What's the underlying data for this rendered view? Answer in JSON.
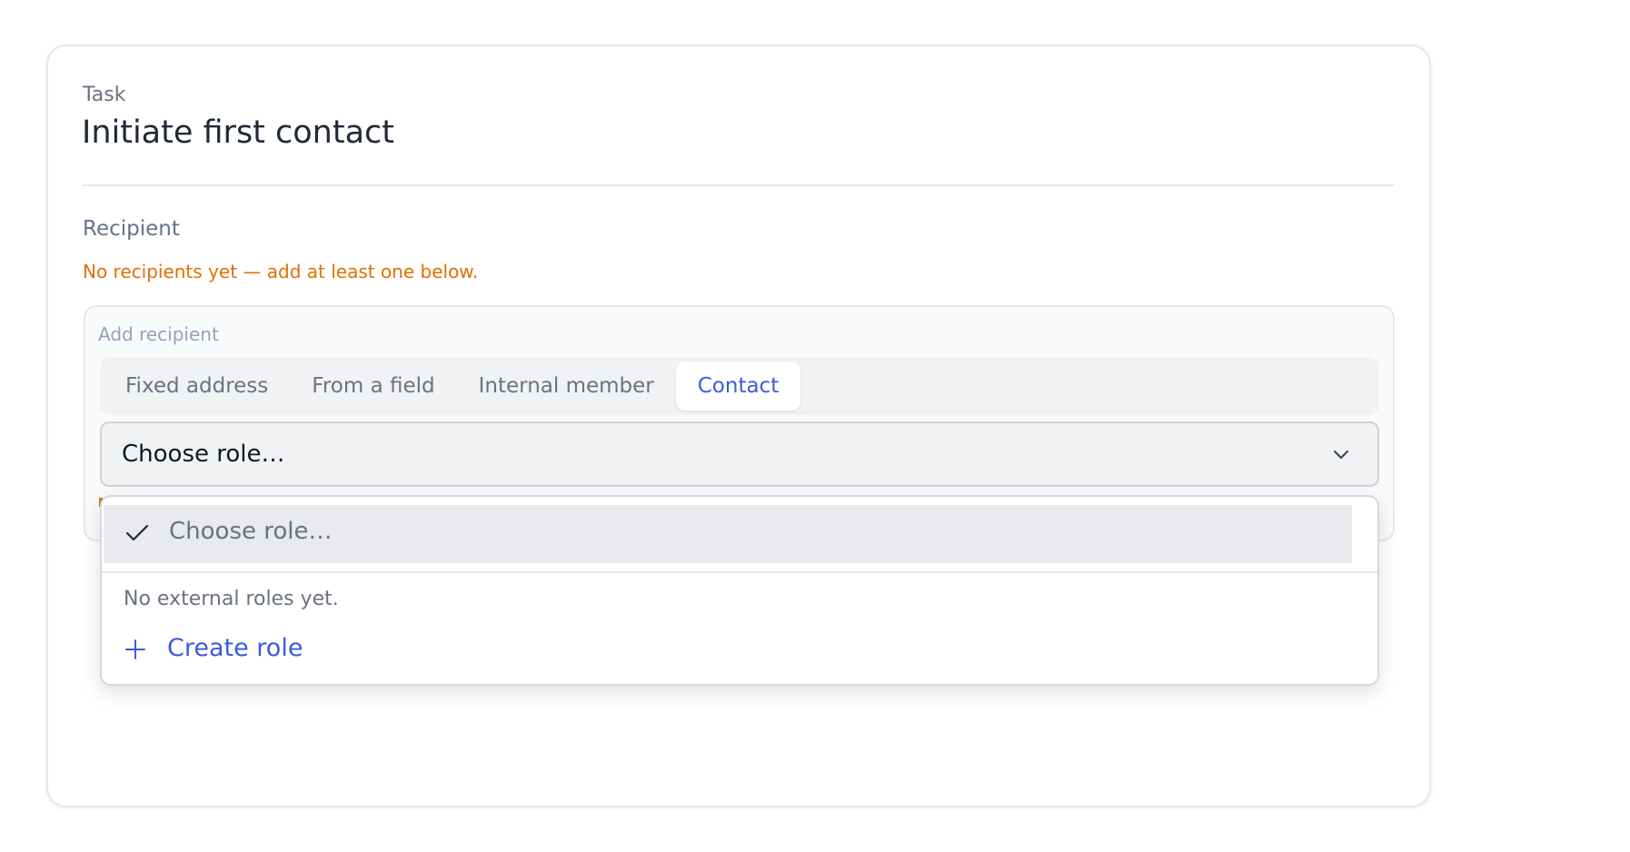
{
  "task": {
    "label": "Task",
    "title": "Initiate first contact"
  },
  "recipient": {
    "label": "Recipient",
    "warning": "No recipients yet — add at least one below.",
    "add_label": "Add recipient",
    "tabs": [
      {
        "label": "Fixed address",
        "active": false
      },
      {
        "label": "From a field",
        "active": false
      },
      {
        "label": "Internal member",
        "active": false
      },
      {
        "label": "Contact",
        "active": true
      }
    ],
    "select": {
      "value": "Choose role…"
    },
    "dropdown": {
      "selected_option": "Choose role…",
      "empty_note": "No external roles yet.",
      "create_label": "Create role"
    }
  },
  "colors": {
    "accent": "#3b5bdb",
    "warning": "#e07000",
    "border": "#e5e7eb"
  },
  "icons": {
    "select": "chevron-down-icon",
    "selected_option": "check-icon",
    "create": "plus-icon"
  }
}
